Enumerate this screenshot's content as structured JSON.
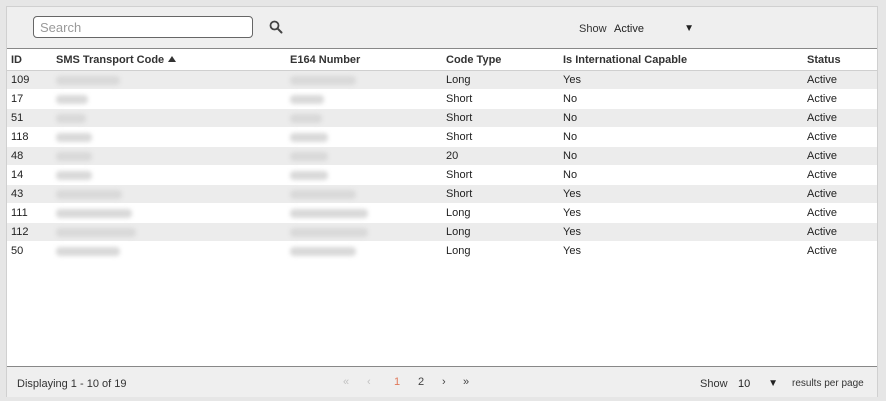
{
  "search": {
    "placeholder": "Search"
  },
  "filter": {
    "label": "Show",
    "value": "Active"
  },
  "table": {
    "columns": [
      "ID",
      "SMS Transport Code",
      "E164 Number",
      "Code Type",
      "Is International Capable",
      "Status"
    ],
    "sorted_column": "SMS Transport Code",
    "sort_direction": "ascending",
    "rows": [
      {
        "id": "109",
        "code_type": "Long",
        "intl": "Yes",
        "status": "Active"
      },
      {
        "id": "17",
        "code_type": "Short",
        "intl": "No",
        "status": "Active"
      },
      {
        "id": "51",
        "code_type": "Short",
        "intl": "No",
        "status": "Active"
      },
      {
        "id": "118",
        "code_type": "Short",
        "intl": "No",
        "status": "Active"
      },
      {
        "id": "48",
        "code_type": "20",
        "intl": "No",
        "status": "Active"
      },
      {
        "id": "14",
        "code_type": "Short",
        "intl": "No",
        "status": "Active"
      },
      {
        "id": "43",
        "code_type": "Short",
        "intl": "Yes",
        "status": "Active"
      },
      {
        "id": "111",
        "code_type": "Long",
        "intl": "Yes",
        "status": "Active"
      },
      {
        "id": "112",
        "code_type": "Long",
        "intl": "Yes",
        "status": "Active"
      },
      {
        "id": "50",
        "code_type": "Long",
        "intl": "Yes",
        "status": "Active"
      }
    ]
  },
  "footer": {
    "displaying": "Displaying 1 - 10 of 19",
    "pages": [
      "1",
      "2"
    ],
    "current_page": "1",
    "results_label": "Show",
    "results_value": "10",
    "results_suffix": "results per page"
  },
  "icons": {
    "search": "search-icon",
    "first": "double-chevron-left-icon",
    "prev": "chevron-left-icon",
    "next": "chevron-right-icon",
    "last": "double-chevron-right-icon",
    "sort": "sort-ascending-icon",
    "dropdown": "dropdown-caret-icon"
  },
  "colors": {
    "active_page": "#e0785a",
    "row_stripe": "#ececec"
  }
}
